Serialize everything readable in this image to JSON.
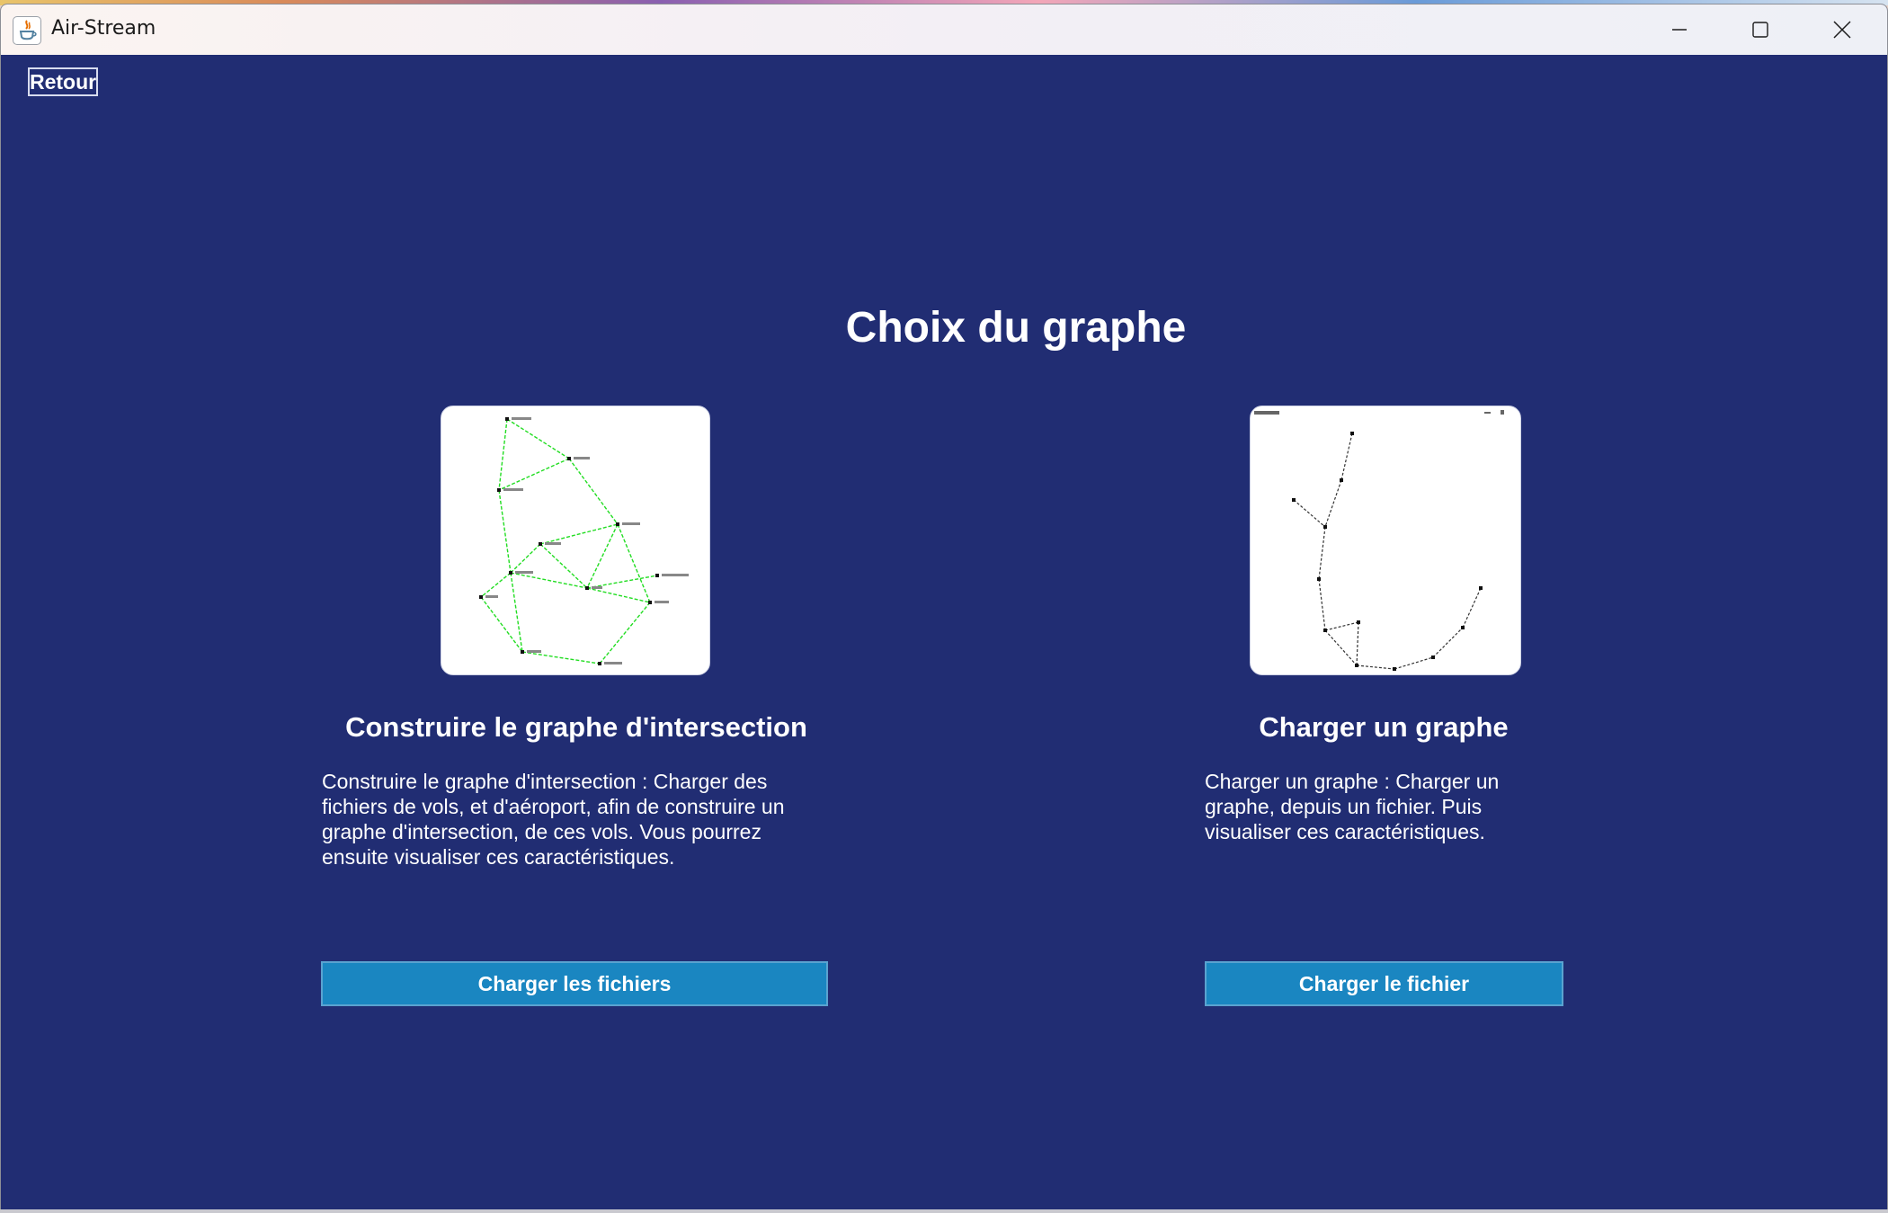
{
  "window": {
    "title": "Air-Stream",
    "controls": [
      "minimize-icon",
      "maximize-icon",
      "close-icon"
    ]
  },
  "nav": {
    "back_label": "Retour"
  },
  "page": {
    "title": "Choix du graphe"
  },
  "cards": [
    {
      "title": "Construire le graphe d'intersection",
      "description_lines": [
        "Construire le graphe d'intersection : Charger des",
        "fichiers de vols, et d'aéroport, afin de construire un",
        "graphe d'intersection, de ces vols. Vous pourrez",
        "ensuite visualiser ces caractéristiques."
      ],
      "button_label": "Charger les fichiers",
      "preview_icon": "intersection-graph-preview"
    },
    {
      "title": "Charger un graphe",
      "description_lines": [
        "Charger un graphe : Charger un",
        "graphe, depuis un fichier. Puis",
        "visualiser ces caractéristiques."
      ],
      "button_label": "Charger le fichier",
      "preview_icon": "loaded-graph-preview"
    }
  ],
  "colors": {
    "background": "#212d73",
    "button": "#1a86c1",
    "edge_green": "#22dd22",
    "text": "#ffffff"
  }
}
